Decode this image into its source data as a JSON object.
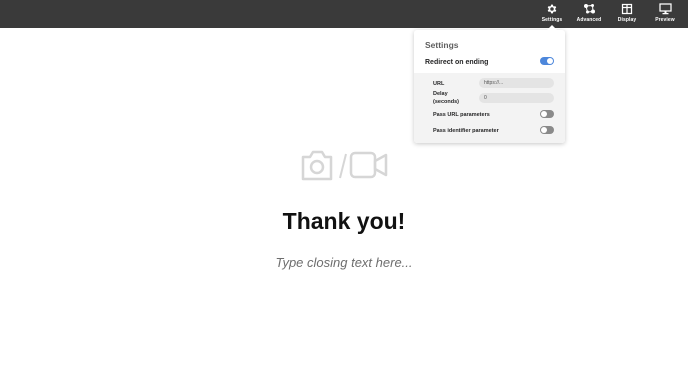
{
  "toolbar": {
    "items": [
      {
        "label": "Settings",
        "icon": "gear-icon"
      },
      {
        "label": "Advanced",
        "icon": "nodes-icon"
      },
      {
        "label": "Display",
        "icon": "layout-icon"
      },
      {
        "label": "Preview",
        "icon": "monitor-icon"
      }
    ],
    "background_color": "#3a3a3a",
    "text_color": "#ffffff"
  },
  "settings_panel": {
    "title": "Settings",
    "redirect_on_ending": {
      "label": "Redirect on ending",
      "enabled": true
    },
    "url": {
      "label": "URL",
      "placeholder": "https://..."
    },
    "delay": {
      "label": "Delay (seconds)",
      "value": "0"
    },
    "pass_url_parameters": {
      "label": "Pass URL parameters",
      "enabled": false
    },
    "pass_identifier_parameter": {
      "label": "Pass identifier parameter",
      "enabled": false
    },
    "toggle_on_color": "#4d87db",
    "toggle_off_color": "#8a8a8a"
  },
  "content": {
    "media_placeholder_icons": [
      "camera-icon",
      "video-camera-icon"
    ],
    "heading": "Thank you!",
    "closing_placeholder": "Type closing text here..."
  }
}
